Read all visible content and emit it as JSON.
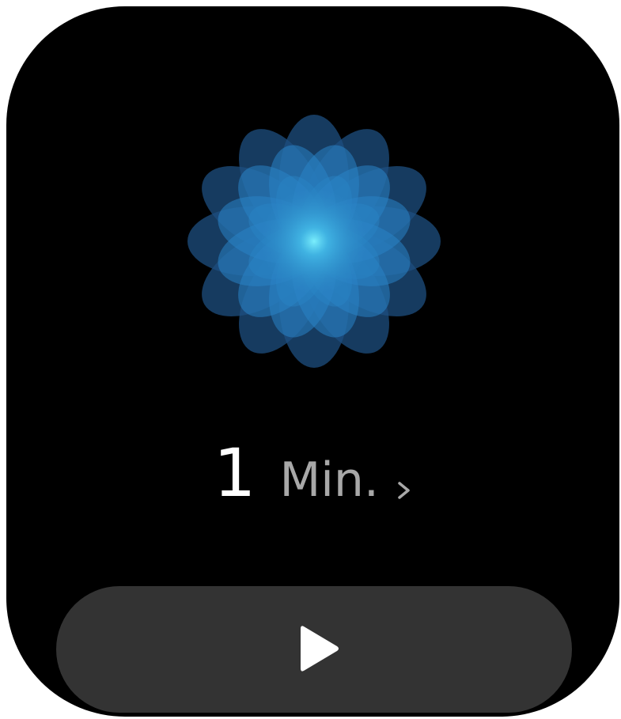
{
  "screen": {
    "background": "#000000"
  },
  "breathe_animation": {
    "icon": "breathing-flower-icon",
    "colors": {
      "outer": "#1d4f80",
      "mid": "#2a84c6",
      "center": "#5fe6ff"
    }
  },
  "duration": {
    "value": "1",
    "unit": "Min.",
    "chevron_icon": "chevron-right-icon"
  },
  "start_button": {
    "icon": "play-icon",
    "background": "#333333"
  }
}
